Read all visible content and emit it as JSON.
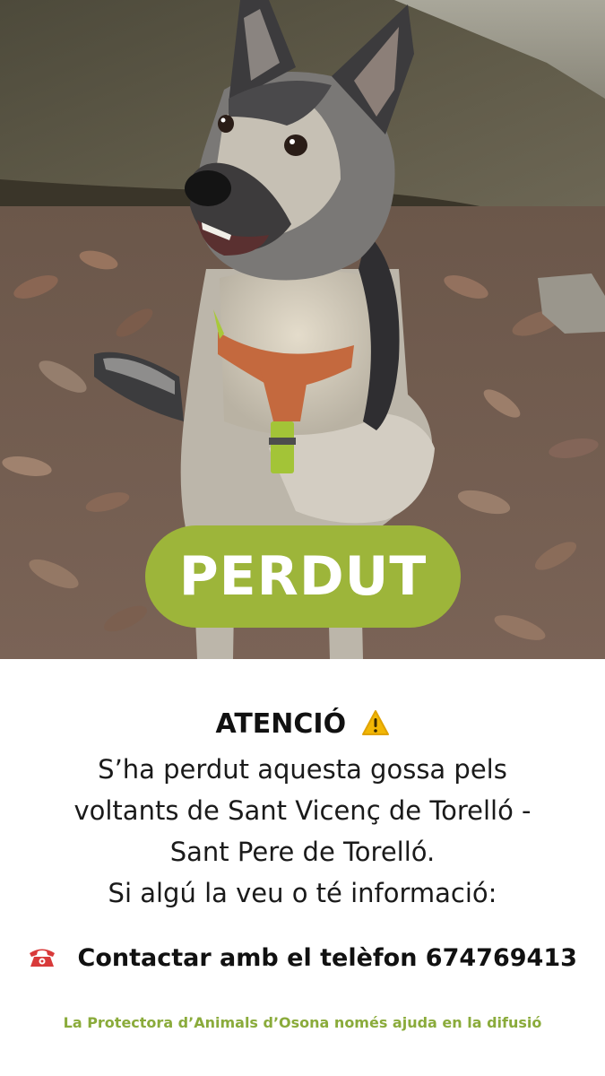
{
  "badge": {
    "label": "PERDUT"
  },
  "notice": {
    "heading": "ATENCIÓ",
    "heading_icon": "warning-icon",
    "lines": [
      "S’ha perdut aquesta gossa pels",
      "voltants de Sant Vicenç de Torelló -",
      "Sant Pere de Torelló.",
      "Si algú la veu o té informació:"
    ]
  },
  "contact": {
    "icon": "telephone-icon",
    "text": "Contactar amb el telèfon 674769413"
  },
  "footer": {
    "text": "La Protectora d’Animals d’Osona només ajuda en la difusió"
  },
  "colors": {
    "badge_green": "#9db53a",
    "footer_green": "#8aab3b",
    "warning_yellow": "#f2b705",
    "phone_red": "#d83a3a"
  }
}
